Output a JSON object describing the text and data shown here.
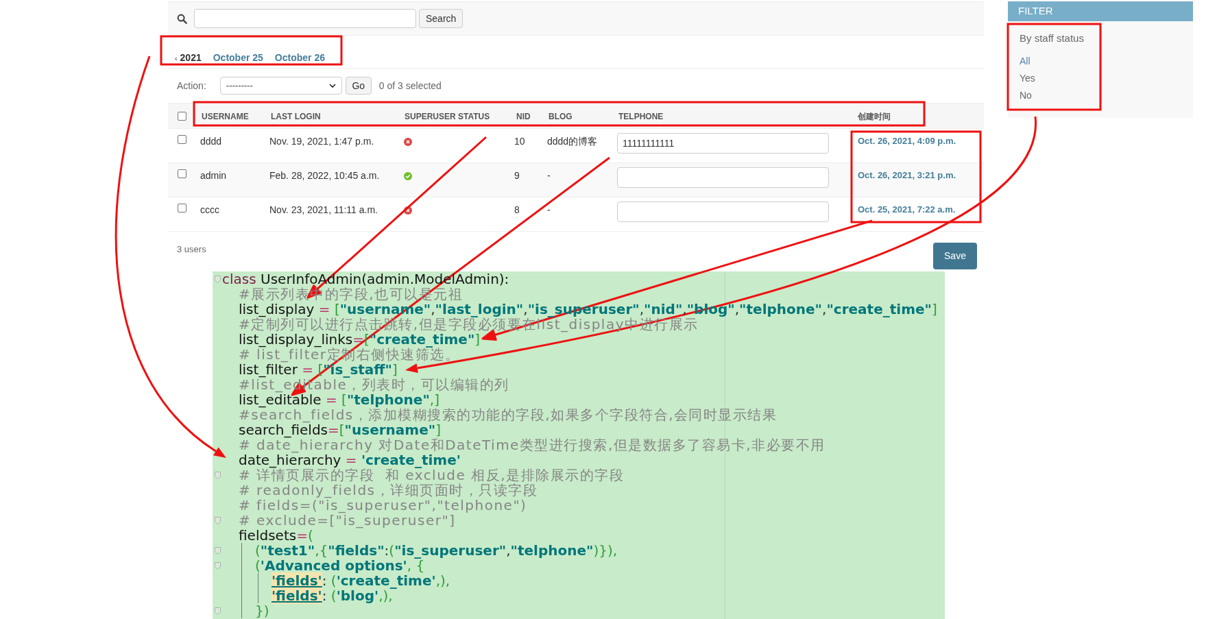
{
  "search": {
    "button": "Search"
  },
  "date_hierarchy": [
    {
      "kind": "back",
      "arrow": "‹",
      "label": "2021"
    },
    {
      "kind": "day",
      "label": "October 25"
    },
    {
      "kind": "day",
      "label": "October 26"
    }
  ],
  "actions": {
    "label": "Action:",
    "selected_action": "---------",
    "go": "Go",
    "counter": "0 of 3 selected"
  },
  "table": {
    "select_all_checked": false,
    "columns": [
      "USERNAME",
      "LAST LOGIN",
      "SUPERUSER STATUS",
      "NID",
      "BLOG",
      "TELPHONE",
      "创建时间"
    ],
    "rows": [
      {
        "checked": false,
        "username": "dddd",
        "last_login": "Nov. 19, 2021, 1:47 p.m.",
        "superuser_status": false,
        "nid": "10",
        "blog": "dddd的博客",
        "telphone": "11111111111",
        "create_time": "Oct. 26, 2021, 4:09 p.m."
      },
      {
        "checked": false,
        "username": "admin",
        "last_login": "Feb. 28, 2022, 10:45 a.m.",
        "superuser_status": true,
        "nid": "9",
        "blog": "-",
        "create_time": "Oct. 26, 2021, 3:21 p.m."
      },
      {
        "checked": false,
        "username": "cccc",
        "last_login": "Nov. 23, 2021, 11:11 a.m.",
        "superuser_status": false,
        "nid": "8",
        "blog": "-",
        "create_time": "Oct. 25, 2021, 7:22 a.m."
      }
    ]
  },
  "result_count": "3 users",
  "save": "Save",
  "filter": {
    "title": "FILTER",
    "heading": "By staff status",
    "options": [
      {
        "label": "All",
        "selected": true
      },
      {
        "label": "Yes",
        "selected": false
      },
      {
        "label": "No",
        "selected": false
      }
    ]
  },
  "code": {
    "lines": [
      {
        "fold": true,
        "guide": false,
        "tokens": [
          {
            "kind": "keyword",
            "text": "class"
          },
          {
            "kind": "name",
            "text": " UserInfoAdmin(admin.ModelAdmin):"
          }
        ],
        "children": [
          {
            "fold": false,
            "tokens": [
              {
                "kind": "comment",
                "text": "#展示列表中的字段,也可以是元祖"
              }
            ]
          },
          {
            "fold": false,
            "tokens": [
              {
                "kind": "name",
                "text": "list_display "
              },
              {
                "kind": "op",
                "text": "= "
              },
              {
                "kind": "bracket",
                "text": "["
              },
              {
                "kind": "string",
                "text": "\"username\""
              },
              {
                "kind": "punct",
                "text": ","
              },
              {
                "kind": "string",
                "text": "\"last_login\""
              },
              {
                "kind": "punct",
                "text": ","
              },
              {
                "kind": "string",
                "text": "\"is_superuser\""
              },
              {
                "kind": "punct",
                "text": ","
              },
              {
                "kind": "string",
                "text": "\"nid\""
              },
              {
                "kind": "punct",
                "text": ","
              },
              {
                "kind": "string",
                "text": "\"blog\""
              },
              {
                "kind": "punct",
                "text": ","
              },
              {
                "kind": "string",
                "text": "\"telphone\""
              },
              {
                "kind": "punct",
                "text": ","
              },
              {
                "kind": "string",
                "text": "\"create_time\""
              },
              {
                "kind": "bracket",
                "text": "]"
              }
            ]
          },
          {
            "fold": false,
            "tokens": [
              {
                "kind": "comment",
                "text": "#定制列可以进行点击跳转,但是字段必须要在list_display中进行展示"
              }
            ]
          },
          {
            "fold": false,
            "tokens": [
              {
                "kind": "name",
                "text": "list_display_links"
              },
              {
                "kind": "op",
                "text": "="
              },
              {
                "kind": "bracket",
                "text": "["
              },
              {
                "kind": "string",
                "text": "\"create_time\""
              },
              {
                "kind": "bracket",
                "text": "]"
              }
            ]
          },
          {
            "fold": false,
            "tokens": [
              {
                "kind": "comment",
                "text": "# list_filter定制右侧快速筛选。"
              }
            ]
          },
          {
            "fold": false,
            "tokens": [
              {
                "kind": "name",
                "text": "list_filter "
              },
              {
                "kind": "op",
                "text": "= "
              },
              {
                "kind": "bracket",
                "text": "["
              },
              {
                "kind": "string",
                "text": "\"is_staff\""
              },
              {
                "kind": "bracket",
                "text": "]"
              }
            ]
          },
          {
            "fold": false,
            "tokens": [
              {
                "kind": "comment",
                "text": "#list_editable，列表时，可以编辑的列"
              }
            ]
          },
          {
            "fold": false,
            "tokens": [
              {
                "kind": "name",
                "text": "list_editable "
              },
              {
                "kind": "op",
                "text": "= "
              },
              {
                "kind": "bracket",
                "text": "["
              },
              {
                "kind": "string",
                "text": "\"telphone\""
              },
              {
                "kind": "bracket",
                "text": ",]"
              }
            ]
          },
          {
            "fold": false,
            "tokens": [
              {
                "kind": "comment",
                "text": "#search_fields，添加模糊搜索的功能的字段,如果多个字段符合,会同时显示结果"
              }
            ]
          },
          {
            "fold": false,
            "tokens": [
              {
                "kind": "name",
                "text": "search_fields"
              },
              {
                "kind": "op",
                "text": "="
              },
              {
                "kind": "bracket",
                "text": "["
              },
              {
                "kind": "string",
                "text": "\"username\""
              },
              {
                "kind": "bracket",
                "text": "]"
              }
            ]
          },
          {
            "fold": false,
            "tokens": [
              {
                "kind": "comment",
                "text": "# date_hierarchy 对Date和DateTime类型进行搜索,但是数据多了容易卡,非必要不用"
              }
            ]
          },
          {
            "fold": false,
            "tokens": [
              {
                "kind": "name",
                "text": "date_hierarchy "
              },
              {
                "kind": "op",
                "text": "= "
              },
              {
                "kind": "string",
                "text": "'create_time'"
              }
            ]
          },
          {
            "fold": true,
            "tokens": [
              {
                "kind": "comment",
                "text": "# 详情页展示的字段  和 exclude 相反,是排除展示的字段"
              }
            ]
          },
          {
            "fold": false,
            "tokens": [
              {
                "kind": "comment",
                "text": "# readonly_fields，详细页面时，只读字段"
              }
            ]
          },
          {
            "fold": false,
            "tokens": [
              {
                "kind": "comment",
                "text": "# fields=(\"is_superuser\",\"telphone\")"
              }
            ]
          },
          {
            "fold": true,
            "tokens": [
              {
                "kind": "comment",
                "text": "# exclude=[\"is_superuser\"]"
              }
            ]
          },
          {
            "fold": false,
            "guide": true,
            "tokens": [
              {
                "kind": "name",
                "text": "fieldsets"
              },
              {
                "kind": "op",
                "text": "="
              },
              {
                "kind": "bracket",
                "text": "("
              }
            ],
            "children": [
              {
                "fold": true,
                "tokens": [
                  {
                    "kind": "bracket",
                    "text": "("
                  },
                  {
                    "kind": "string",
                    "text": "\"test1\""
                  },
                  {
                    "kind": "bracket",
                    "text": ",{"
                  },
                  {
                    "kind": "string",
                    "text": "\"fields\""
                  },
                  {
                    "kind": "punct",
                    "text": ":"
                  },
                  {
                    "kind": "bracket",
                    "text": "("
                  },
                  {
                    "kind": "string",
                    "text": "\"is_superuser\""
                  },
                  {
                    "kind": "punct",
                    "text": ","
                  },
                  {
                    "kind": "string",
                    "text": "\"telphone\""
                  },
                  {
                    "kind": "bracket",
                    "text": ")}),"
                  }
                ]
              },
              {
                "fold": true,
                "guide": true,
                "tokens": [
                  {
                    "kind": "bracket",
                    "text": "("
                  },
                  {
                    "kind": "string",
                    "text": "'Advanced options'"
                  },
                  {
                    "kind": "bracket",
                    "text": ", {"
                  }
                ],
                "children": [
                  {
                    "fold": false,
                    "tokens": [
                      {
                        "kind": "key",
                        "text": "'fields'"
                      },
                      {
                        "kind": "punct",
                        "text": ": "
                      },
                      {
                        "kind": "bracket",
                        "text": "("
                      },
                      {
                        "kind": "string",
                        "text": "'create_time'"
                      },
                      {
                        "kind": "bracket",
                        "text": ",),"
                      }
                    ]
                  },
                  {
                    "fold": false,
                    "tokens": [
                      {
                        "kind": "key",
                        "text": "'fields'"
                      },
                      {
                        "kind": "punct",
                        "text": ": "
                      },
                      {
                        "kind": "bracket",
                        "text": "("
                      },
                      {
                        "kind": "string",
                        "text": "'blog'"
                      },
                      {
                        "kind": "bracket",
                        "text": ",),"
                      }
                    ]
                  }
                ]
              },
              {
                "fold": true,
                "tokens": [
                  {
                    "kind": "bracket",
                    "text": "})"
                  }
                ]
              }
            ]
          }
        ]
      }
    ]
  }
}
